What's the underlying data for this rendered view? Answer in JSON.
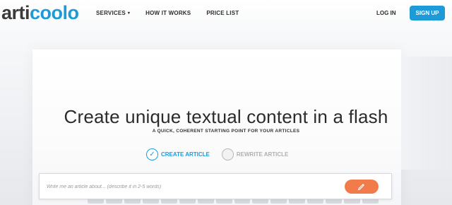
{
  "brand": {
    "logo_left": "arti",
    "logo_accent": "coolo",
    "accent_color": "#1e9bd7"
  },
  "nav": {
    "items": [
      {
        "label": "SERVICES",
        "has_dropdown": true
      },
      {
        "label": "HOW IT WORKS"
      },
      {
        "label": "PRICE LIST"
      }
    ],
    "login_label": "LOG IN",
    "signup_label": "SIGN UP"
  },
  "hero": {
    "title": "Create unique textual content in a flash",
    "subtitle": "A QUICK, COHERENT STARTING POINT FOR YOUR ARTICLES"
  },
  "mode_options": [
    {
      "label": "CREATE ARTICLE",
      "selected": true,
      "icon": "check-icon"
    },
    {
      "label": "REWRITE ARTICLE",
      "selected": false
    }
  ],
  "prompt": {
    "placeholder": "Write me an article about... (describe it in 2-5 words)",
    "submit_icon": "pencil-icon",
    "submit_color": "#f27b4b"
  }
}
